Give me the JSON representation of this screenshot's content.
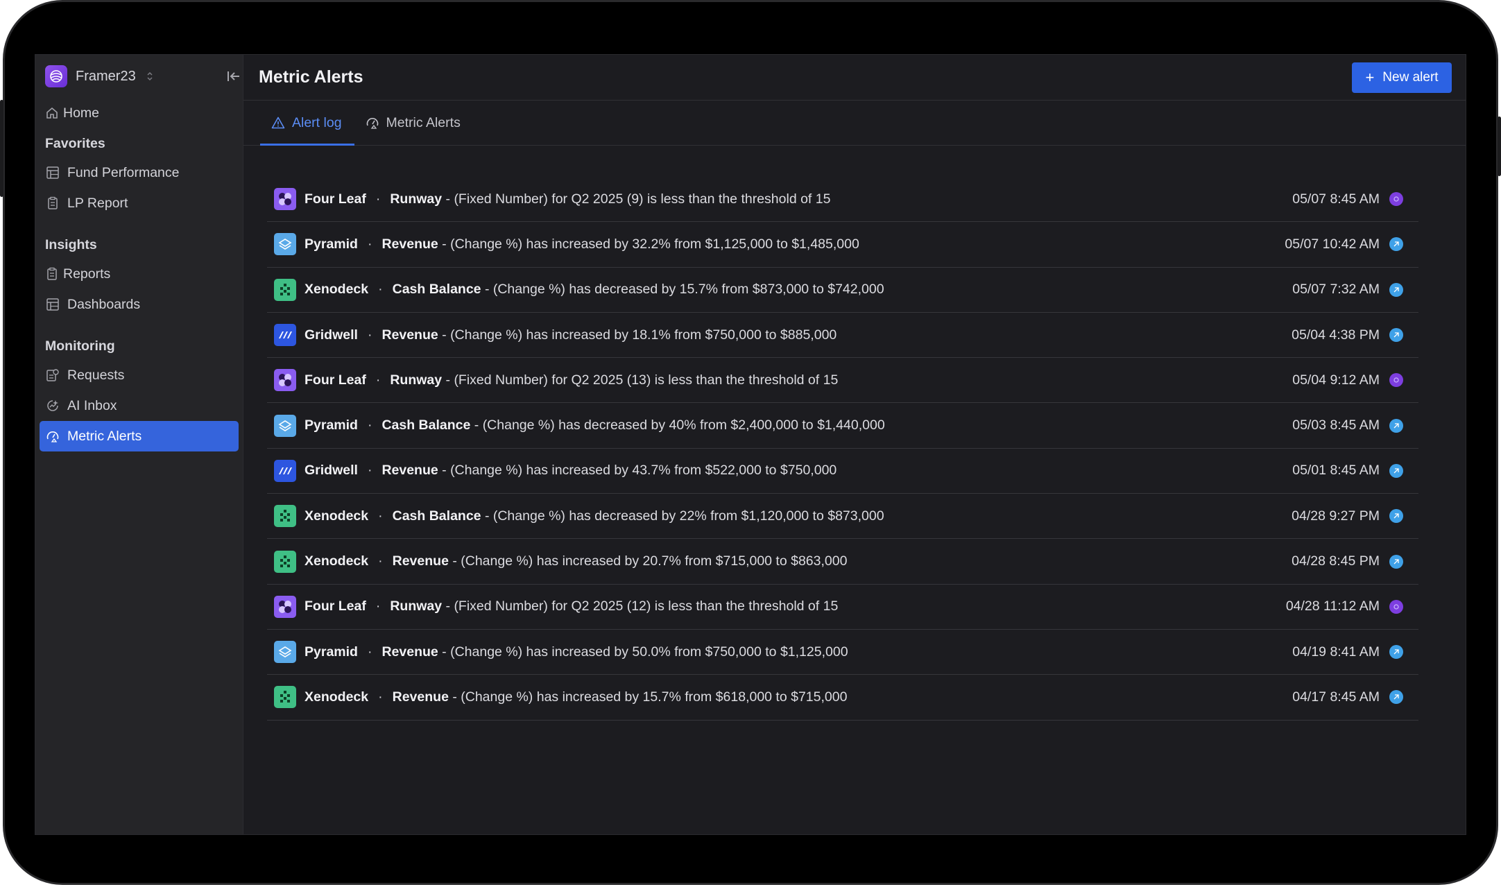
{
  "workspace": {
    "name": "Framer23"
  },
  "sidebar": {
    "home": "Home",
    "sections": [
      {
        "title": "Favorites",
        "items": [
          {
            "label": "Fund Performance",
            "icon": "grid-calendar-icon"
          },
          {
            "label": "LP Report",
            "icon": "clipboard-icon"
          }
        ]
      },
      {
        "title": "Insights",
        "items": [
          {
            "label": "Reports",
            "icon": "clipboard-icon"
          },
          {
            "label": "Dashboards",
            "icon": "grid-calendar-icon"
          }
        ]
      },
      {
        "title": "Monitoring",
        "items": [
          {
            "label": "Requests",
            "icon": "request-icon"
          },
          {
            "label": "AI Inbox",
            "icon": "ai-inbox-icon"
          },
          {
            "label": "Metric Alerts",
            "icon": "alert-gauge-icon",
            "active": true
          }
        ]
      }
    ]
  },
  "header": {
    "title": "Metric Alerts",
    "new_button": "New alert"
  },
  "tabs": [
    {
      "label": "Alert log",
      "active": true
    },
    {
      "label": "Metric Alerts",
      "active": false
    }
  ],
  "alerts": [
    {
      "company": "Four Leaf",
      "logo": "fourleaf",
      "metric": "Runway",
      "desc": " - (Fixed Number) for Q2 2025 (9) is less than the threshold of 15",
      "time": "05/07 8:45 AM",
      "avatar": "purple"
    },
    {
      "company": "Pyramid",
      "logo": "pyramid",
      "metric": "Revenue",
      "desc": " - (Change %) has increased by 32.2% from $1,125,000 to $1,485,000",
      "time": "05/07 10:42 AM",
      "avatar": "blue"
    },
    {
      "company": "Xenodeck",
      "logo": "xenodeck",
      "metric": "Cash Balance",
      "desc": " - (Change %) has decreased by 15.7% from $873,000 to $742,000",
      "time": "05/07 7:32 AM",
      "avatar": "blue"
    },
    {
      "company": "Gridwell",
      "logo": "gridwell",
      "metric": "Revenue",
      "desc": " - (Change %) has increased by 18.1% from $750,000 to $885,000",
      "time": "05/04 4:38 PM",
      "avatar": "blue"
    },
    {
      "company": "Four Leaf",
      "logo": "fourleaf",
      "metric": "Runway",
      "desc": " - (Fixed Number) for Q2 2025 (13) is less than the threshold of 15",
      "time": "05/04 9:12 AM",
      "avatar": "purple"
    },
    {
      "company": "Pyramid",
      "logo": "pyramid",
      "metric": "Cash Balance",
      "desc": " - (Change %) has decreased by 40% from $2,400,000 to $1,440,000",
      "time": "05/03 8:45 AM",
      "avatar": "blue"
    },
    {
      "company": "Gridwell",
      "logo": "gridwell",
      "metric": "Revenue",
      "desc": " - (Change %) has increased by 43.7% from $522,000 to $750,000",
      "time": "05/01 8:45 AM",
      "avatar": "blue"
    },
    {
      "company": "Xenodeck",
      "logo": "xenodeck",
      "metric": "Cash Balance",
      "desc": " - (Change %) has decreased by 22% from $1,120,000 to $873,000",
      "time": "04/28 9:27 PM",
      "avatar": "blue"
    },
    {
      "company": "Xenodeck",
      "logo": "xenodeck",
      "metric": "Revenue",
      "desc": " - (Change %) has increased by 20.7% from $715,000 to $863,000",
      "time": "04/28 8:45 PM",
      "avatar": "blue"
    },
    {
      "company": "Four Leaf",
      "logo": "fourleaf",
      "metric": "Runway",
      "desc": " - (Fixed Number) for Q2 2025 (12) is less than the threshold of 15",
      "time": "04/28 11:12 AM",
      "avatar": "purple"
    },
    {
      "company": "Pyramid",
      "logo": "pyramid",
      "metric": "Revenue",
      "desc": " - (Change %) has increased by 50.0% from $750,000 to $1,125,000",
      "time": "04/19 8:41 AM",
      "avatar": "blue"
    },
    {
      "company": "Xenodeck",
      "logo": "xenodeck",
      "metric": "Revenue",
      "desc": " - (Change %) has increased by 15.7% from $618,000 to $715,000",
      "time": "04/17 8:45 AM",
      "avatar": "blue"
    }
  ],
  "colors": {
    "accent": "#2c62e3",
    "active_nav": "#3564dc",
    "background": "#1c1c20",
    "sidebar": "#252528"
  }
}
